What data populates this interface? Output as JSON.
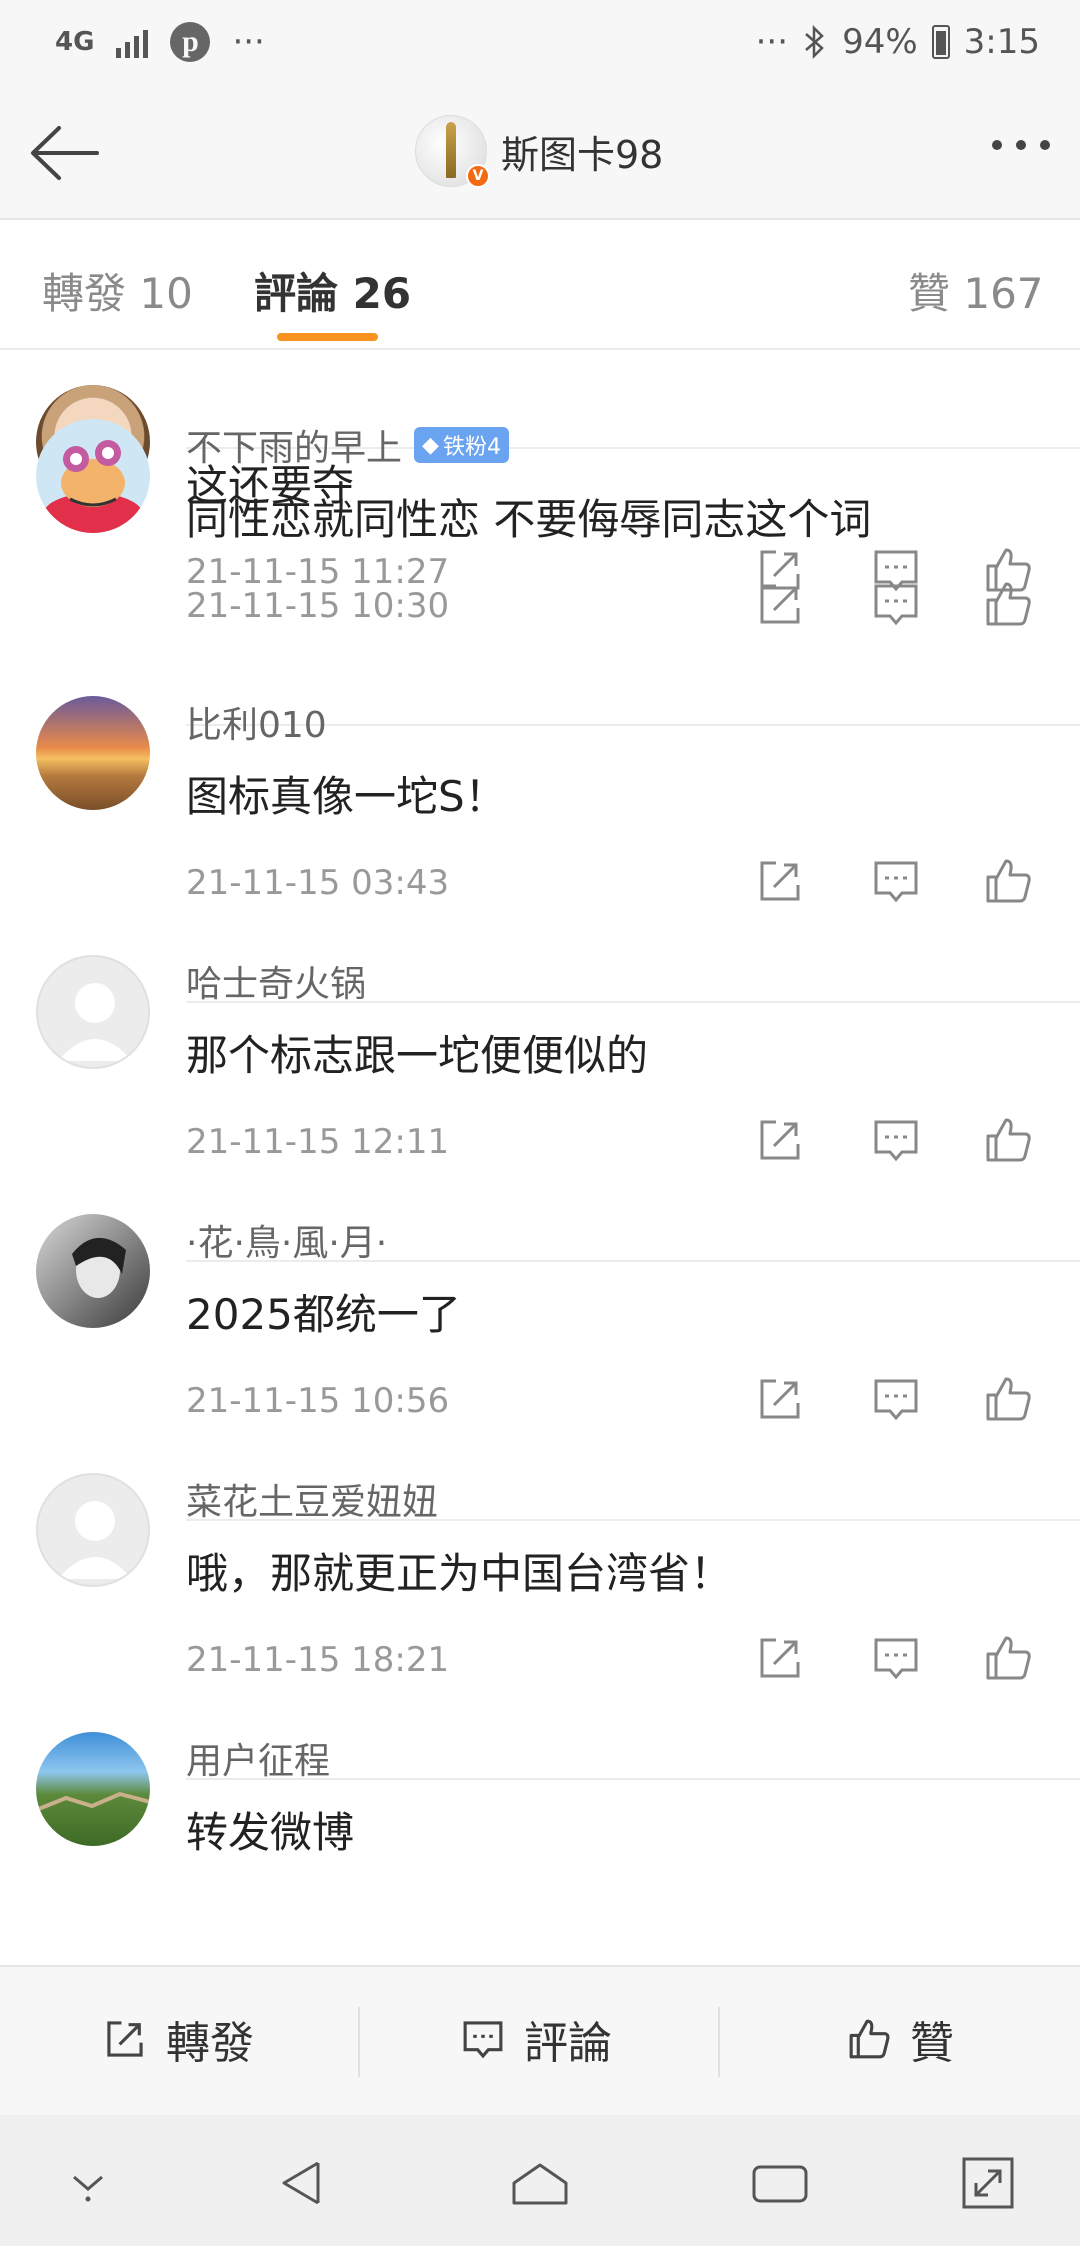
{
  "status_bar": {
    "network": "4G",
    "overflow": "···",
    "overflow_right": "···",
    "battery": "94%",
    "time": "3:15"
  },
  "header": {
    "title": "斯图卡98",
    "verified": "V"
  },
  "tabs": [
    {
      "label": "轉發 10"
    },
    {
      "label": "評論 26"
    },
    {
      "label": "贊 167"
    }
  ],
  "comments": [
    {
      "username": "",
      "text": "这还要夺",
      "time": "21-11-15 11:27"
    },
    {
      "username": "不下雨的早上",
      "badge": "铁粉4",
      "text": "同性恋就同性恋  不要侮辱同志这个词",
      "time": "21-11-15 10:30"
    },
    {
      "username": "比利010",
      "text": "图标真像一坨S！",
      "time": "21-11-15 03:43"
    },
    {
      "username": "哈士奇火锅",
      "text": "那个标志跟一坨便便似的",
      "time": "21-11-15 12:11"
    },
    {
      "username": "·花·鳥·風·月·",
      "text": "2025都统一了",
      "time": "21-11-15 10:56"
    },
    {
      "username": "菜花土豆爱妞妞",
      "text": "哦，那就更正为中国台湾省！",
      "time": "21-11-15 18:21"
    },
    {
      "username": "用户征程",
      "text": "转发微博",
      "time": ""
    }
  ],
  "toolbar": {
    "repost": "轉發",
    "comment": "評論",
    "like": "贊"
  },
  "colors": {
    "accent": "#f7931e",
    "badge": "#6aa4f0",
    "verified": "#f26a12"
  }
}
